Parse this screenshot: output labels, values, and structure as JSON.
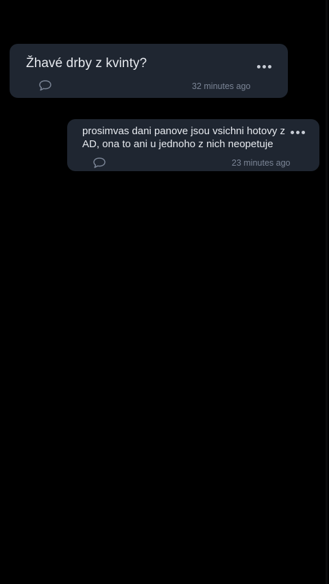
{
  "post": {
    "title": "Žhavé drby z kvinty?",
    "timestamp": "32 minutes ago",
    "comment_icon": "comment-bubble-icon",
    "more_icon": "more-horizontal-icon"
  },
  "reply": {
    "text": "prosimvas dani panove jsou vsichni hotovy z AD, ona to ani u jednoho z nich neopetuje",
    "timestamp": "23 minutes ago",
    "comment_icon": "comment-bubble-icon",
    "more_icon": "more-horizontal-icon"
  },
  "colors": {
    "background": "#000000",
    "card": "#1f2631",
    "text": "#e8ebf0",
    "muted": "#7b8596"
  }
}
